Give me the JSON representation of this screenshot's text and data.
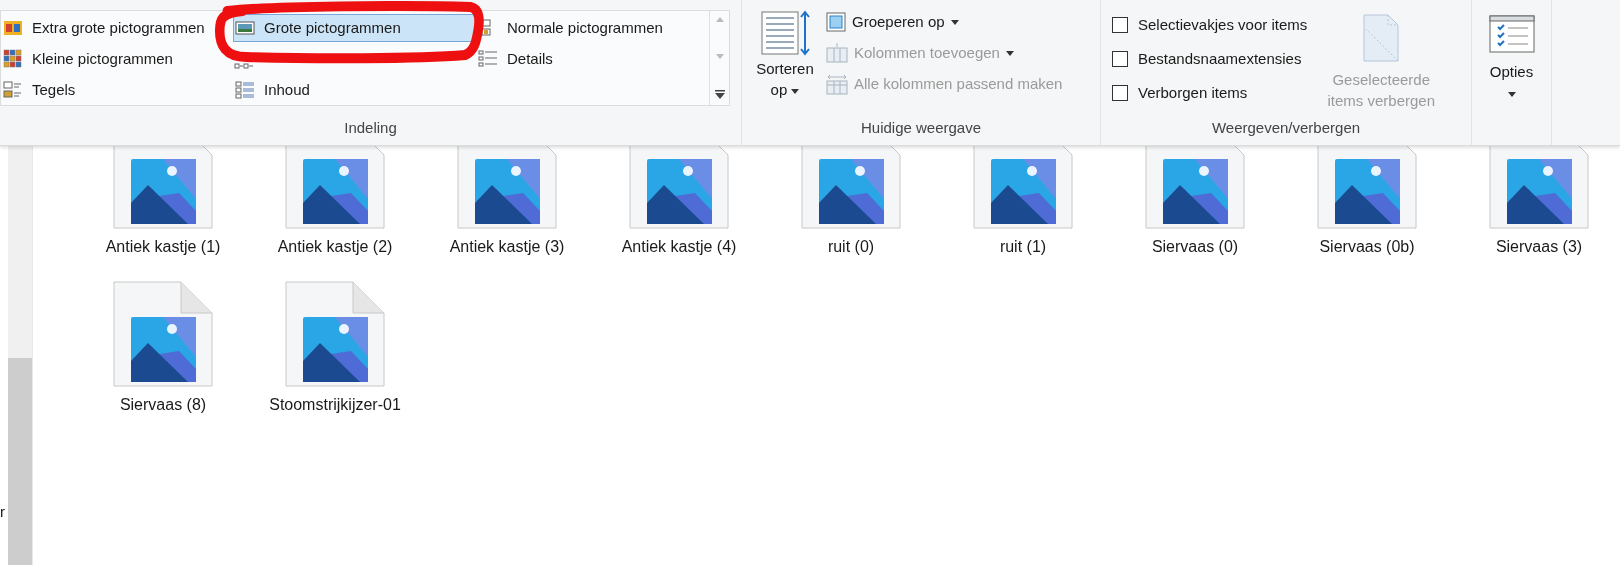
{
  "ribbon": {
    "layout": {
      "items": [
        {
          "kind": "extra-large",
          "label": "Extra grote pictogrammen",
          "selected": false
        },
        {
          "kind": "large",
          "label": "Grote pictogrammen",
          "selected": true
        },
        {
          "kind": "medium",
          "label": "Normale pictogrammen",
          "selected": false
        },
        {
          "kind": "small",
          "label": "Kleine pictogrammen",
          "selected": false
        },
        {
          "kind": "details",
          "label": "Details",
          "selected": false
        },
        {
          "kind": "tiles",
          "label": "Tegels",
          "selected": false
        },
        {
          "kind": "content",
          "label": "Inhoud",
          "selected": false
        }
      ],
      "group_label": "Indeling"
    },
    "current_view": {
      "sort_button": "Sorteren op",
      "group_by": {
        "label": "Groeperen op",
        "disabled": false
      },
      "add_columns": {
        "label": "Kolommen toevoegen",
        "disabled": true
      },
      "fit_columns": {
        "label": "Alle kolommen passend maken",
        "disabled": true
      },
      "group_label": "Huidige weergave"
    },
    "show_hide": {
      "checkboxes": [
        {
          "label": "Selectievakjes voor items",
          "checked": false
        },
        {
          "label": "Bestandsnaamextensies",
          "checked": false
        },
        {
          "label": "Verborgen items",
          "checked": false
        }
      ],
      "hide_selected": {
        "label": "Geselecteerde items verbergen",
        "disabled": true
      },
      "group_label": "Weergeven/verbergen"
    },
    "options": {
      "label": "Opties"
    }
  },
  "sidebar": {
    "item_cut": "r"
  },
  "files": {
    "rows": [
      [
        "Antiek kastje (1)",
        "Antiek kastje (2)",
        "Antiek kastje (3)",
        "Antiek kastje (4)",
        "ruit (0)",
        "ruit (1)",
        "Siervaas (0)",
        "Siervaas (0b)",
        "Siervaas (3)"
      ],
      [
        "Siervaas (8)",
        "Stoomstrijkijzer-01"
      ]
    ]
  }
}
